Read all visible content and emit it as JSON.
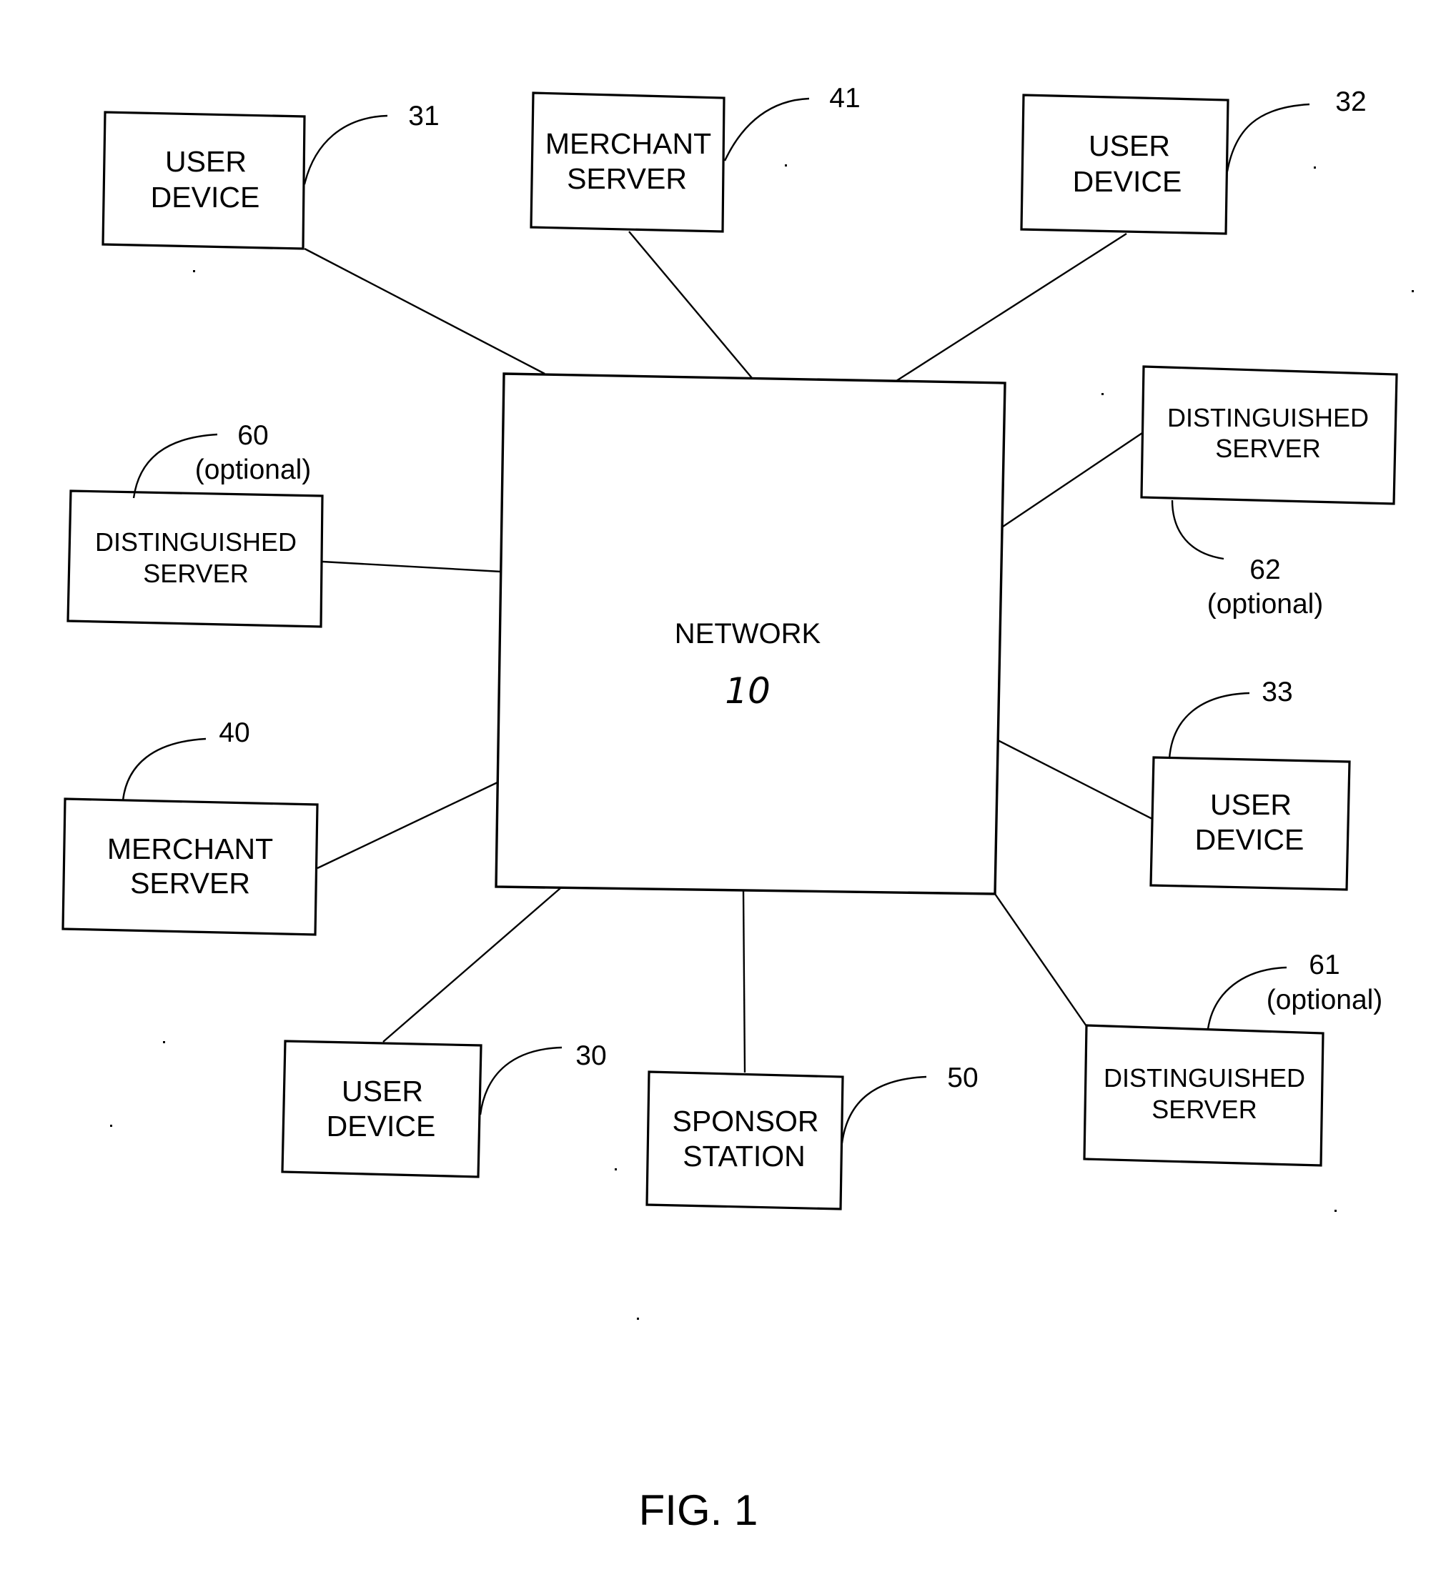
{
  "figure": {
    "caption": "FIG. 1",
    "network": {
      "label": "NETWORK",
      "ref": "10"
    },
    "nodes": [
      {
        "id": "user-device-31",
        "lines": [
          "USER",
          "DEVICE"
        ],
        "ref": "31",
        "note": ""
      },
      {
        "id": "merchant-server-41",
        "lines": [
          "MERCHANT",
          "SERVER"
        ],
        "ref": "41",
        "note": ""
      },
      {
        "id": "user-device-32",
        "lines": [
          "USER",
          "DEVICE"
        ],
        "ref": "32",
        "note": ""
      },
      {
        "id": "distinguished-server-62",
        "lines": [
          "DISTINGUISHED",
          "SERVER"
        ],
        "ref": "62",
        "note": "(optional)"
      },
      {
        "id": "distinguished-server-60",
        "lines": [
          "DISTINGUISHED",
          "SERVER"
        ],
        "ref": "60",
        "note": "(optional)"
      },
      {
        "id": "merchant-server-40",
        "lines": [
          "MERCHANT",
          "SERVER"
        ],
        "ref": "40",
        "note": ""
      },
      {
        "id": "user-device-33",
        "lines": [
          "USER",
          "DEVICE"
        ],
        "ref": "33",
        "note": ""
      },
      {
        "id": "user-device-30",
        "lines": [
          "USER",
          "DEVICE"
        ],
        "ref": "30",
        "note": ""
      },
      {
        "id": "sponsor-station-50",
        "lines": [
          "SPONSOR",
          "STATION"
        ],
        "ref": "50",
        "note": ""
      },
      {
        "id": "distinguished-server-61",
        "lines": [
          "DISTINGUISHED",
          "SERVER"
        ],
        "ref": "61",
        "note": "(optional)"
      }
    ],
    "connections": [
      {
        "from": "user-device-31",
        "to": "network"
      },
      {
        "from": "merchant-server-41",
        "to": "network"
      },
      {
        "from": "user-device-32",
        "to": "network"
      },
      {
        "from": "distinguished-server-62",
        "to": "network"
      },
      {
        "from": "distinguished-server-60",
        "to": "network"
      },
      {
        "from": "merchant-server-40",
        "to": "network"
      },
      {
        "from": "user-device-33",
        "to": "network"
      },
      {
        "from": "user-device-30",
        "to": "network"
      },
      {
        "from": "sponsor-station-50",
        "to": "network"
      },
      {
        "from": "distinguished-server-61",
        "to": "network"
      }
    ]
  }
}
